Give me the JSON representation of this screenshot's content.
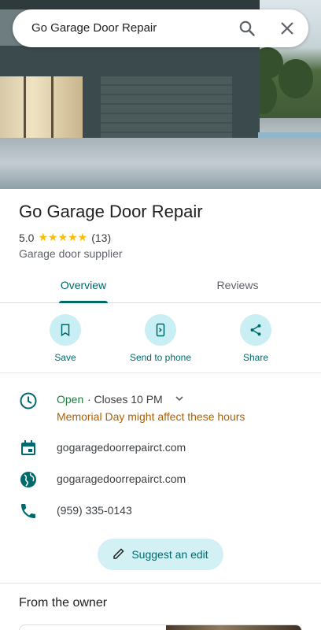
{
  "search": {
    "query": "Go Garage Door Repair"
  },
  "place": {
    "name": "Go Garage Door Repair",
    "rating": "5.0",
    "stars": "★★★★★",
    "review_count": "(13)",
    "category": "Garage door supplier"
  },
  "tabs": [
    {
      "label": "Overview",
      "selected": true
    },
    {
      "label": "Reviews",
      "selected": false
    }
  ],
  "actions": [
    {
      "label": "Save",
      "icon": "bookmark-icon"
    },
    {
      "label": "Send to phone",
      "icon": "send-to-phone-icon"
    },
    {
      "label": "Share",
      "icon": "share-icon"
    }
  ],
  "hours": {
    "status": "Open",
    "closes": "· Closes 10 PM",
    "note": "Memorial Day might affect these hours"
  },
  "info": {
    "booking": "gogaragedoorrepairct.com",
    "website": "gogaragedoorrepairct.com",
    "phone": "(959) 335-0143"
  },
  "suggest_edit": "Suggest an edit",
  "owner_section": "From the owner",
  "colors": {
    "accent": "#00696b",
    "open": "#188038",
    "warning": "#b06000",
    "star": "#fbbc04",
    "chip_bg": "#c9eef3"
  }
}
